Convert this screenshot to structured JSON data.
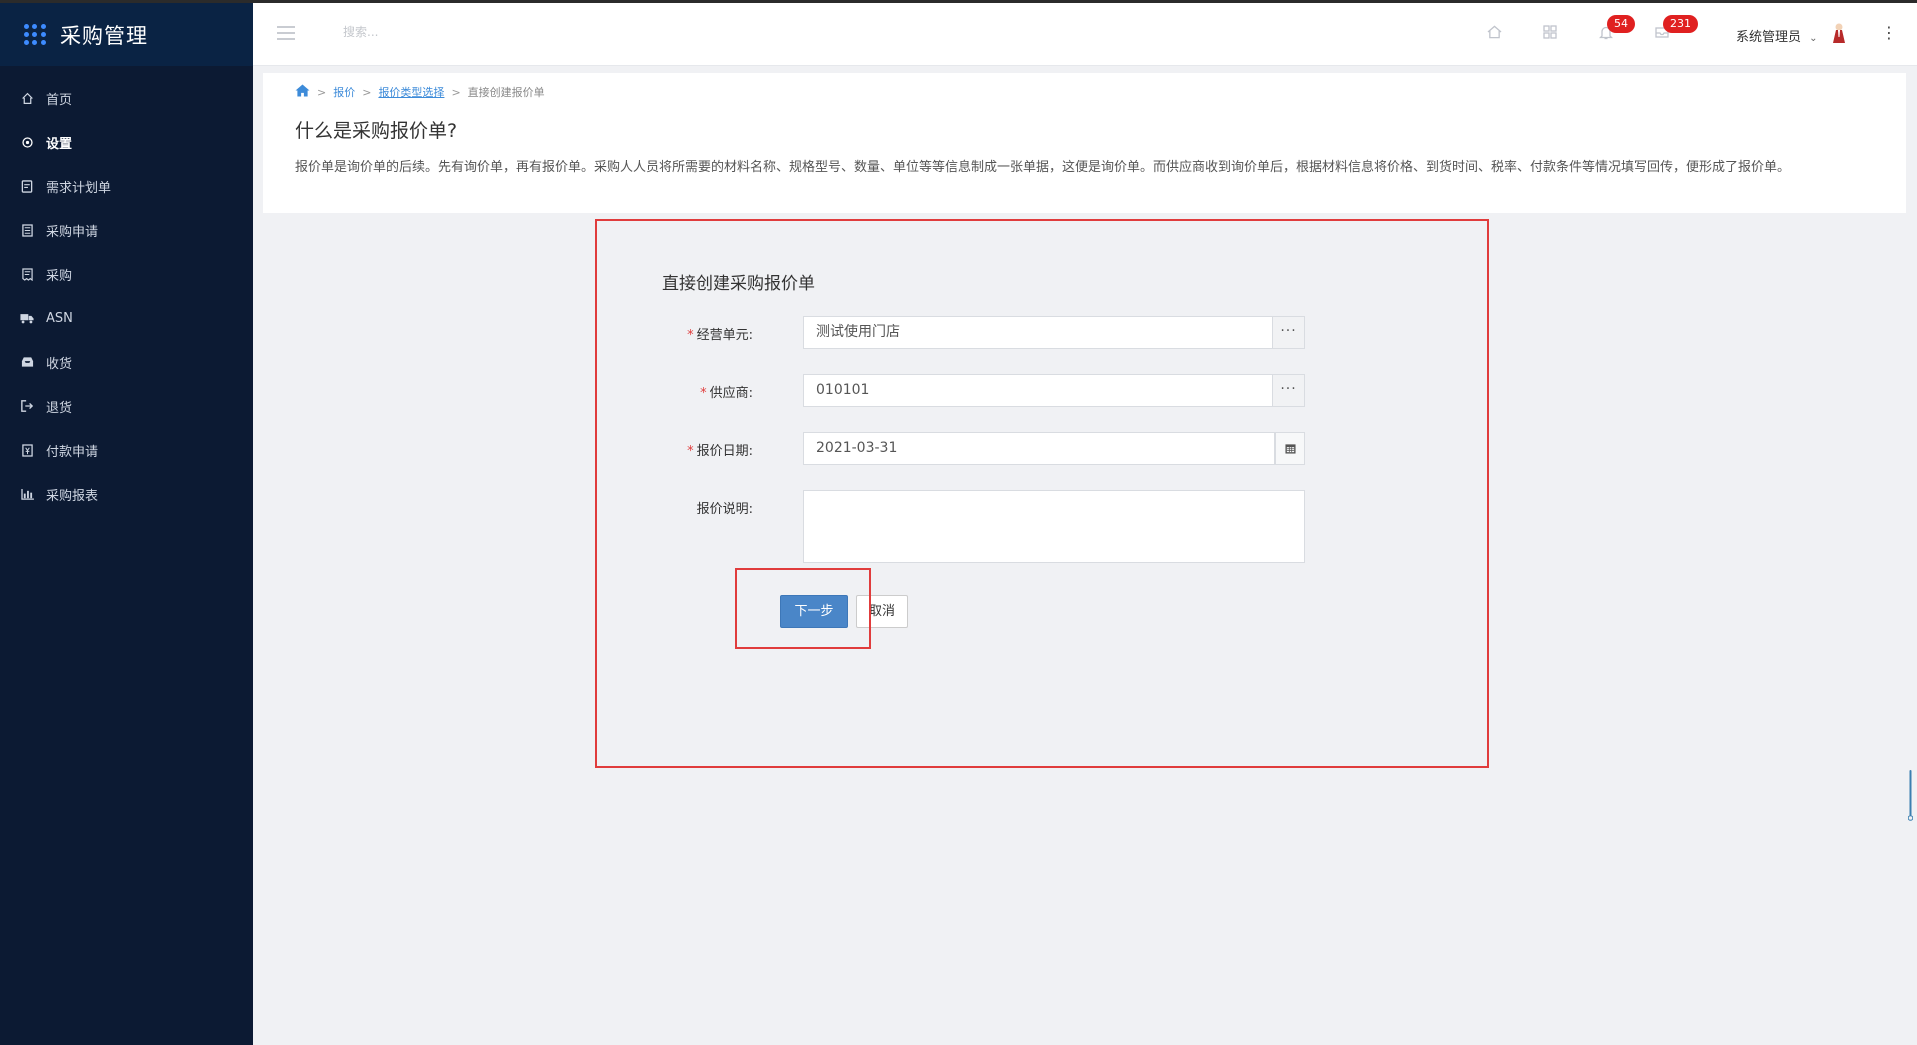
{
  "app": {
    "title": "采购管理"
  },
  "sidebar": {
    "items": [
      {
        "label": "首页",
        "icon": "home-icon"
      },
      {
        "label": "设置",
        "icon": "gear-icon"
      },
      {
        "label": "需求计划单",
        "icon": "note-icon"
      },
      {
        "label": "采购申请",
        "icon": "document-icon"
      },
      {
        "label": "采购",
        "icon": "receipt-icon"
      },
      {
        "label": "ASN",
        "icon": "truck-icon"
      },
      {
        "label": "收货",
        "icon": "inbox-icon"
      },
      {
        "label": "退货",
        "icon": "return-icon"
      },
      {
        "label": "付款申请",
        "icon": "payment-icon"
      },
      {
        "label": "采购报表",
        "icon": "bar-chart-icon"
      }
    ]
  },
  "header": {
    "search_placeholder": "搜索...",
    "notifications_count": "54",
    "messages_count": "231",
    "user_name": "系统管理员"
  },
  "breadcrumb": {
    "items": [
      "报价",
      "报价类型选择",
      "直接创建报价单"
    ]
  },
  "info": {
    "heading": "什么是采购报价单?",
    "description": "报价单是询价单的后续。先有询价单，再有报价单。采购人人员将所需要的材料名称、规格型号、数量、单位等等信息制成一张单据，这便是询价单。而供应商收到询价单后，根据材料信息将价格、到货时间、税率、付款条件等情况填写回传，便形成了报价单。"
  },
  "form": {
    "title": "直接创建采购报价单",
    "business_unit_label": "经营单元:",
    "business_unit_value": "测试使用门店",
    "supplier_label": "供应商:",
    "supplier_value": "010101",
    "quote_date_label": "报价日期:",
    "quote_date_value": "2021-03-31",
    "quote_note_label": "报价说明:",
    "quote_note_value": "",
    "next_label": "下一步",
    "cancel_label": "取消",
    "browse_label": "···"
  },
  "colors": {
    "sidebar_bg": "#0c1a33",
    "accent": "#4a86c8",
    "highlight": "#e03c3c",
    "badge": "#e02020"
  }
}
